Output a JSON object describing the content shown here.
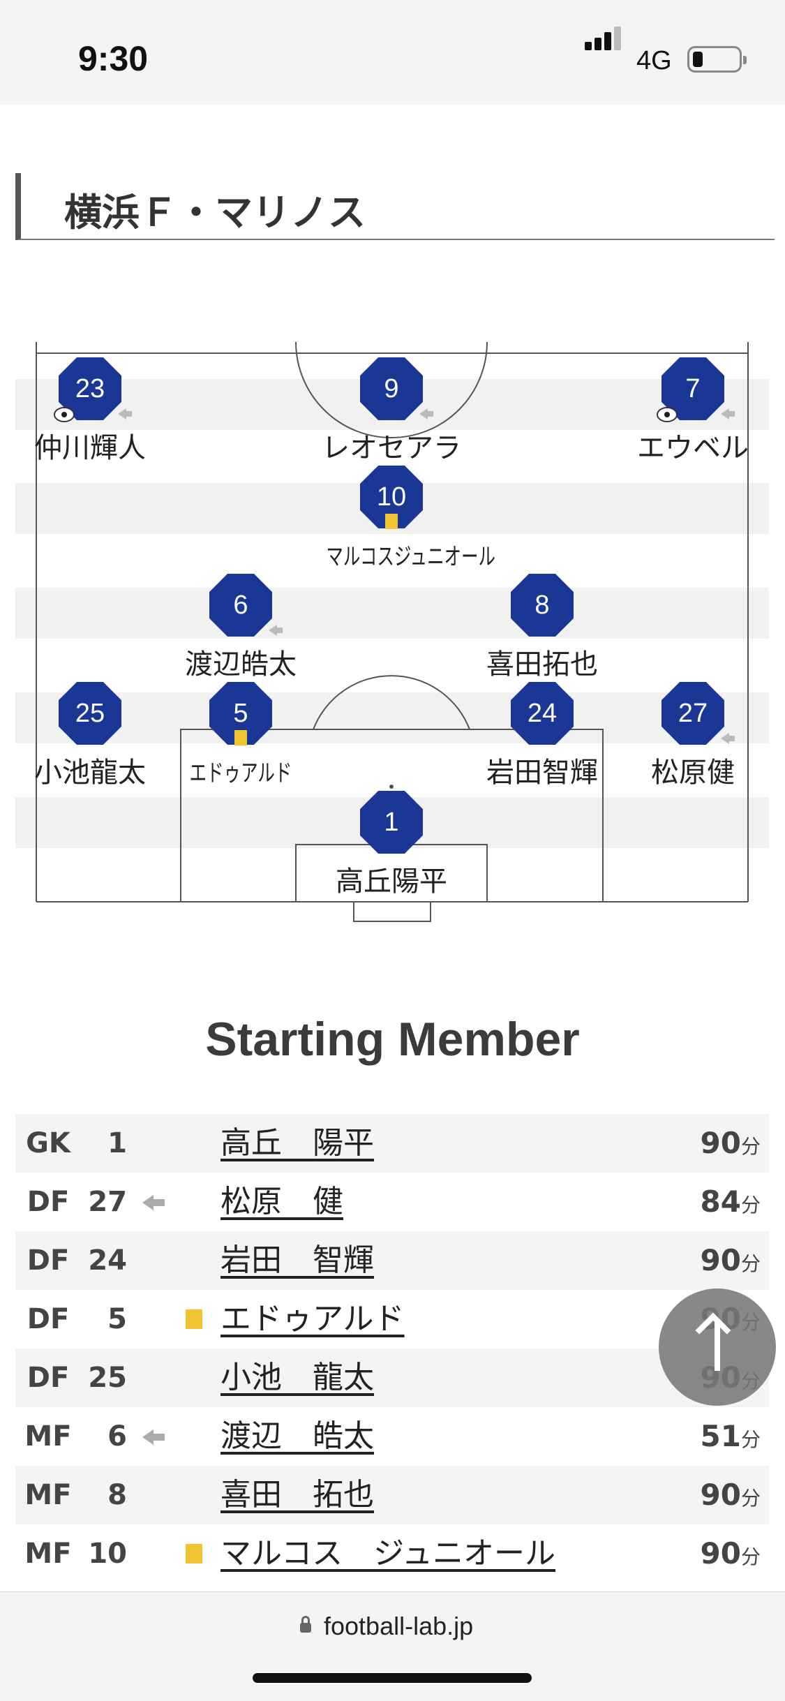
{
  "status": {
    "time": "9:30",
    "network": "4G"
  },
  "team": {
    "name": "横浜Ｆ・マリノス"
  },
  "formation": [
    {
      "num": "23",
      "name": "仲川輝人",
      "goal": true,
      "sub": true,
      "card": false,
      "narrow": false
    },
    {
      "num": "9",
      "name": "レオセアラ",
      "goal": false,
      "sub": true,
      "card": false,
      "narrow": false
    },
    {
      "num": "7",
      "name": "エウベル",
      "goal": true,
      "sub": true,
      "card": false,
      "narrow": false
    },
    {
      "num": "10",
      "name": "マルコスジュニオール",
      "goal": false,
      "sub": false,
      "card": true,
      "narrow": true
    },
    {
      "num": "6",
      "name": "渡辺皓太",
      "goal": false,
      "sub": true,
      "card": false,
      "narrow": false
    },
    {
      "num": "8",
      "name": "喜田拓也",
      "goal": false,
      "sub": false,
      "card": false,
      "narrow": false
    },
    {
      "num": "25",
      "name": "小池龍太",
      "goal": false,
      "sub": false,
      "card": false,
      "narrow": false
    },
    {
      "num": "5",
      "name": "エドゥアルド",
      "goal": false,
      "sub": false,
      "card": true,
      "narrow": true
    },
    {
      "num": "24",
      "name": "岩田智輝",
      "goal": false,
      "sub": false,
      "card": false,
      "narrow": false
    },
    {
      "num": "27",
      "name": "松原健",
      "goal": false,
      "sub": true,
      "card": false,
      "narrow": false
    },
    {
      "num": "1",
      "name": "高丘陽平",
      "goal": false,
      "sub": false,
      "card": false,
      "narrow": false
    }
  ],
  "starting_member": {
    "title": "Starting Member",
    "minutes_unit": "分",
    "rows": [
      {
        "pos": "GK",
        "num": "1",
        "name": "高丘　陽平",
        "minutes": "90",
        "sub": false,
        "card": false
      },
      {
        "pos": "DF",
        "num": "27",
        "name": "松原　健",
        "minutes": "84",
        "sub": true,
        "card": false
      },
      {
        "pos": "DF",
        "num": "24",
        "name": "岩田　智輝",
        "minutes": "90",
        "sub": false,
        "card": false
      },
      {
        "pos": "DF",
        "num": "5",
        "name": "エドゥアルド",
        "minutes": "90",
        "sub": false,
        "card": true
      },
      {
        "pos": "DF",
        "num": "25",
        "name": "小池　龍太",
        "minutes": "90",
        "sub": false,
        "card": false
      },
      {
        "pos": "MF",
        "num": "6",
        "name": "渡辺　皓太",
        "minutes": "51",
        "sub": true,
        "card": false
      },
      {
        "pos": "MF",
        "num": "8",
        "name": "喜田　拓也",
        "minutes": "90",
        "sub": false,
        "card": false
      },
      {
        "pos": "MF",
        "num": "10",
        "name": "マルコス　ジュニオール",
        "minutes": "90",
        "sub": false,
        "card": true
      }
    ]
  },
  "browser": {
    "url": "football-lab.jp"
  },
  "icons": {
    "scroll_top": "arrow-up-icon",
    "lock": "lock-icon",
    "goal": "soccer-ball-icon",
    "substitution": "substitution-arrow-icon",
    "yellow_card": "yellow-card-icon"
  },
  "colors": {
    "player_badge": "#1b3796",
    "yellow_card": "#f1c232"
  }
}
